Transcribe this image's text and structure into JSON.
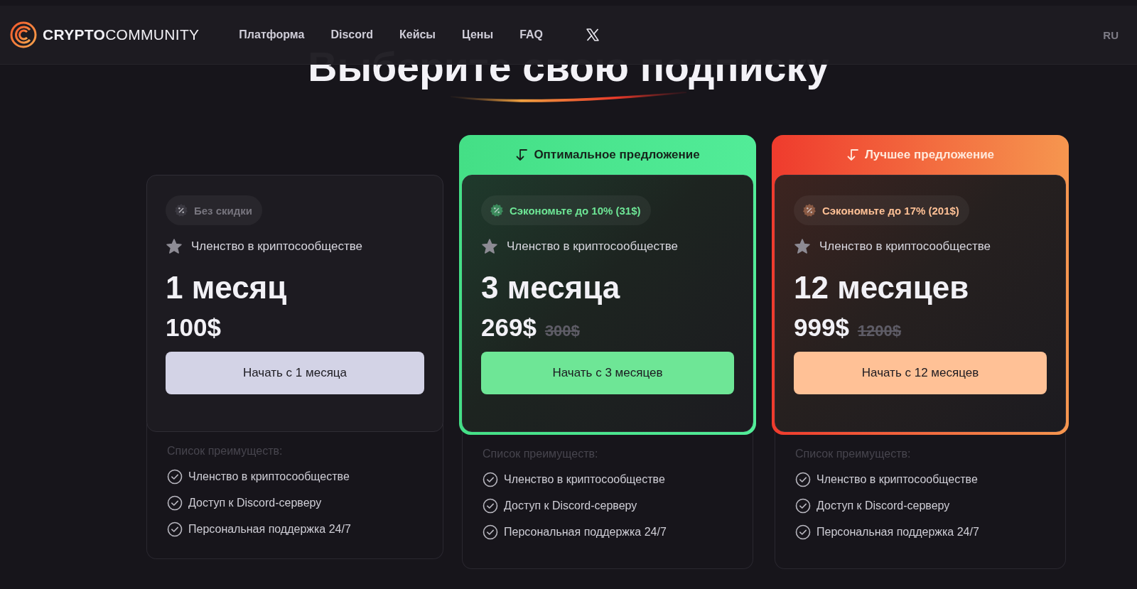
{
  "header": {
    "logo": {
      "bold": "CRYPTO",
      "light": "COMMUNITY"
    },
    "nav": [
      {
        "label": "Платформа"
      },
      {
        "label": "Discord"
      },
      {
        "label": "Кейсы"
      },
      {
        "label": "Цены"
      },
      {
        "label": "FAQ"
      }
    ],
    "language": "RU"
  },
  "title": "Выберите свою подписку",
  "plans": [
    {
      "kind": "standard",
      "discount": "Без скидки",
      "membership": "Членство в криптосообществе",
      "duration": "1 месяц",
      "price": "100$",
      "button": "Начать с 1 месяца",
      "benefits_title": "Список преимуществ:",
      "benefits": [
        "Членство в криптосообществе",
        "Доступ к Discord-серверу",
        "Персональная поддержка 24/7"
      ]
    },
    {
      "kind": "optimal",
      "banner": "Оптимальное предложение",
      "discount": "Сэкономьте до 10% (31$)",
      "membership": "Членство в криптосообществе",
      "duration": "3 месяца",
      "price": "269$",
      "old_price": "300$",
      "button": "Начать с 3 месяцев",
      "benefits_title": "Список преимуществ:",
      "benefits": [
        "Членство в криптосообществе",
        "Доступ к Discord-серверу",
        "Персональная поддержка 24/7"
      ]
    },
    {
      "kind": "best",
      "banner": "Лучшее предложение",
      "discount": "Сэкономьте до 17% (201$)",
      "membership": "Членство в криптосообществе",
      "duration": "12 месяцев",
      "price": "999$",
      "old_price": "1200$",
      "button": "Начать с 12 месяцев",
      "benefits_title": "Список преимуществ:",
      "benefits": [
        "Членство в криптосообществе",
        "Доступ к Discord-серверу",
        "Персональная поддержка 24/7"
      ]
    }
  ]
}
